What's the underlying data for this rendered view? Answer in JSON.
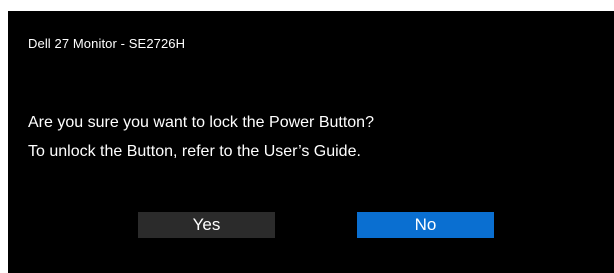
{
  "dialog": {
    "title": "Dell 27 Monitor - SE2726H",
    "message_lines": [
      "Are you sure you want to lock the Power Button?",
      "To unlock the Button, refer to the User’s Guide."
    ],
    "buttons": {
      "yes_label": "Yes",
      "no_label": "No"
    }
  },
  "colors": {
    "background": "#000000",
    "text": "#ffffff",
    "yes_button": "#2b2b2b",
    "no_button": "#0a6fd1"
  }
}
